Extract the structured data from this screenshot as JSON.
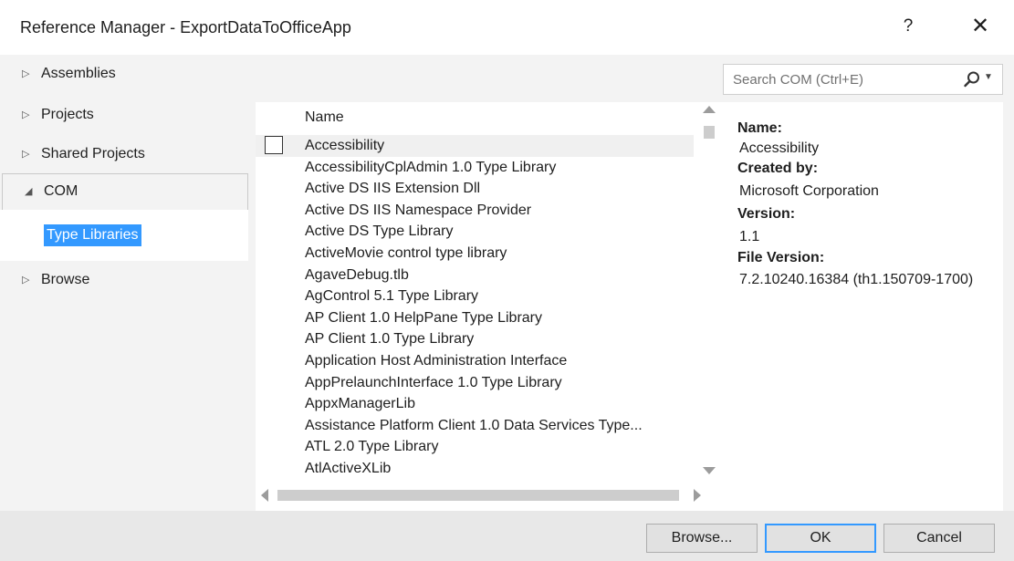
{
  "window": {
    "title": "Reference Manager - ExportDataToOfficeApp",
    "help_label": "?",
    "close_label": "✕"
  },
  "nav": {
    "items": [
      {
        "label": "Assemblies",
        "expanded": false
      },
      {
        "label": "Projects",
        "expanded": false
      },
      {
        "label": "Shared Projects",
        "expanded": false
      },
      {
        "label": "COM",
        "expanded": true
      },
      {
        "label": "Browse",
        "expanded": false
      }
    ],
    "sub_item": "Type Libraries",
    "arrow_collapsed": "▷",
    "arrow_expanded": "◢"
  },
  "search": {
    "placeholder": "Search COM (Ctrl+E)",
    "value": ""
  },
  "list": {
    "column_header": "Name",
    "rows": [
      "Accessibility",
      "AccessibilityCplAdmin 1.0 Type Library",
      "Active DS IIS Extension Dll",
      "Active DS IIS Namespace Provider",
      "Active DS Type Library",
      "ActiveMovie control type library",
      "AgaveDebug.tlb",
      "AgControl 5.1 Type Library",
      "AP Client 1.0 HelpPane Type Library",
      "AP Client 1.0 Type Library",
      "Application Host Administration Interface",
      "AppPrelaunchInterface 1.0 Type Library",
      "AppxManagerLib",
      "Assistance Platform Client 1.0 Data Services Type...",
      "ATL 2.0 Type Library",
      "AtlActiveXLib"
    ],
    "selected_index": 0
  },
  "details": {
    "name_label": "Name:",
    "name_value": "Accessibility",
    "created_label": "Created by:",
    "created_value": "Microsoft Corporation",
    "version_label": "Version:",
    "version_value": "1.1",
    "file_version_label": "File Version:",
    "file_version_value": "7.2.10240.16384 (th1.150709-1700)"
  },
  "footer": {
    "browse_label": "Browse...",
    "ok_label": "OK",
    "cancel_label": "Cancel"
  },
  "colors": {
    "selection": "#3399ff",
    "dialog_bg": "#f3f3f3",
    "footer_bg": "#e8e8e8"
  }
}
